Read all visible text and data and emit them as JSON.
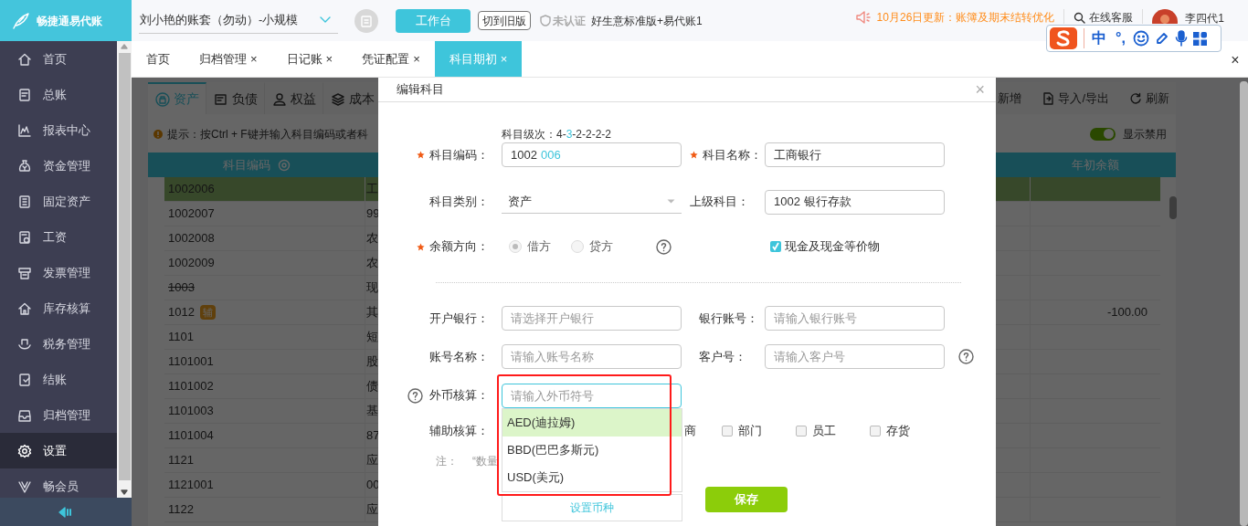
{
  "header": {
    "logo_text": "畅捷通易代账",
    "account": "刘小艳的账套（勿动）-小规模",
    "workbench_button": "工作台",
    "switch_button": "切到旧版",
    "cert_status": "未认证",
    "edition": "好生意标准版+易代账1",
    "notice": "10月26日更新：账簿及期末结转优化",
    "support": "在线客服",
    "user": "李四代1"
  },
  "ime_toolbar": {
    "items": [
      "中",
      "°,"
    ]
  },
  "sidebar": {
    "items": [
      {
        "label": "首页",
        "selected": false
      },
      {
        "label": "总账",
        "selected": false
      },
      {
        "label": "报表中心",
        "selected": false
      },
      {
        "label": "资金管理",
        "selected": false
      },
      {
        "label": "固定资产",
        "selected": false
      },
      {
        "label": "工资",
        "selected": false
      },
      {
        "label": "发票管理",
        "selected": false
      },
      {
        "label": "库存核算",
        "selected": false
      },
      {
        "label": "税务管理",
        "selected": false
      },
      {
        "label": "结账",
        "selected": false
      },
      {
        "label": "归档管理",
        "selected": false
      },
      {
        "label": "设置",
        "selected": true
      },
      {
        "label": "畅会员",
        "selected": false
      }
    ]
  },
  "tabs": [
    {
      "label": "首页",
      "selected": false
    },
    {
      "label": "归档管理",
      "close": "×",
      "selected": false
    },
    {
      "label": "日记账",
      "close": "×",
      "selected": false
    },
    {
      "label": "凭证配置",
      "close": "×",
      "selected": false
    },
    {
      "label": "科目期初",
      "close": "×",
      "selected": true
    }
  ],
  "page_close": "×",
  "background": {
    "category_tabs": [
      {
        "label": "资产",
        "selected": true
      },
      {
        "label": "负债",
        "selected": false
      },
      {
        "label": "权益",
        "selected": false
      },
      {
        "label": "成本",
        "selected": false
      }
    ],
    "actions": [
      "新增",
      "导入/导出",
      "刷新"
    ],
    "hint": "提示：按Ctrl + F键并输入科目编码或者科",
    "show_disabled": {
      "label": "显示禁用",
      "on": true
    },
    "table": {
      "columns": [
        "科目编码",
        "年初余额"
      ],
      "rows": [
        {
          "code": "1002006",
          "column_2": "工",
          "selected": true,
          "disabled": false
        },
        {
          "code": "1002007",
          "column_2": "99",
          "selected": false,
          "disabled": false
        },
        {
          "code": "1002008",
          "column_2": "农",
          "selected": false,
          "disabled": false
        },
        {
          "code": "1002009",
          "column_2": "农",
          "selected": false,
          "disabled": false
        },
        {
          "code": "1003",
          "column_2": "现",
          "selected": false,
          "disabled": true
        },
        {
          "code": "1012",
          "badge": "辅",
          "column_2": "其",
          "balance": "-100.00",
          "selected": false,
          "disabled": false
        },
        {
          "code": "1101",
          "column_2": "短",
          "selected": false,
          "disabled": false
        },
        {
          "code": "1101001",
          "column_2": "股",
          "selected": false,
          "disabled": false
        },
        {
          "code": "1101002",
          "column_2": "债",
          "selected": false,
          "disabled": false
        },
        {
          "code": "1101003",
          "column_2": "基",
          "selected": false,
          "disabled": false
        },
        {
          "code": "1101004",
          "column_2": "87",
          "selected": false,
          "disabled": false
        },
        {
          "code": "1121",
          "column_2": "应",
          "selected": false,
          "disabled": false
        },
        {
          "code": "1121001",
          "column_2": "00",
          "selected": false,
          "disabled": false
        },
        {
          "code": "1122",
          "column_2": "应",
          "selected": false,
          "disabled": false
        }
      ]
    }
  },
  "dialog": {
    "title": "编辑科目",
    "close": "×",
    "level_hint": {
      "prefix": "科目级次：4-",
      "current": "3",
      "suffix": "-2-2-2-2"
    },
    "code": {
      "label": "科目编码：",
      "required": true,
      "value_prefix": "1002",
      "value_suffix": "006"
    },
    "name": {
      "label": "科目名称：",
      "required": true,
      "value": "工商银行"
    },
    "category": {
      "label": "科目类别：",
      "required": false,
      "value": "资产"
    },
    "parent": {
      "label": "上级科目：",
      "required": false,
      "value": "1002 银行存款"
    },
    "direction": {
      "label": "余额方向：",
      "required": true,
      "disabled": true,
      "options": [
        {
          "label": "借方",
          "selected": true
        },
        {
          "label": "贷方",
          "selected": false
        }
      ]
    },
    "cash_equivalent": {
      "label": "现金及现金等价物",
      "checked": true
    },
    "bank": {
      "label": "开户银行：",
      "placeholder": "请选择开户银行"
    },
    "bank_account": {
      "label": "银行账号：",
      "placeholder": "请输入银行账号"
    },
    "account_name": {
      "label": "账号名称：",
      "placeholder": "请输入账号名称"
    },
    "customer_no": {
      "label": "客户号：",
      "placeholder": "请输入客户号"
    },
    "currency": {
      "label": "外币核算：",
      "placeholder": "请输入外币符号",
      "focused": true,
      "options": [
        {
          "label": "AED(迪拉姆)",
          "selected": true
        },
        {
          "label": "BBD(巴巴多斯元)",
          "selected": false
        },
        {
          "label": "USD(美元)",
          "selected": false
        }
      ],
      "footer": "设置币种"
    },
    "auxiliary": {
      "label": "辅助核算：",
      "partial_label": "商",
      "items": [
        {
          "label": "部门",
          "checked": false
        },
        {
          "label": "员工",
          "checked": false
        },
        {
          "label": "存货",
          "checked": false
        }
      ]
    },
    "note": {
      "label": "注：",
      "text": "“数量"
    },
    "save": "保存"
  },
  "annotation": {
    "kind": "rectangle"
  }
}
